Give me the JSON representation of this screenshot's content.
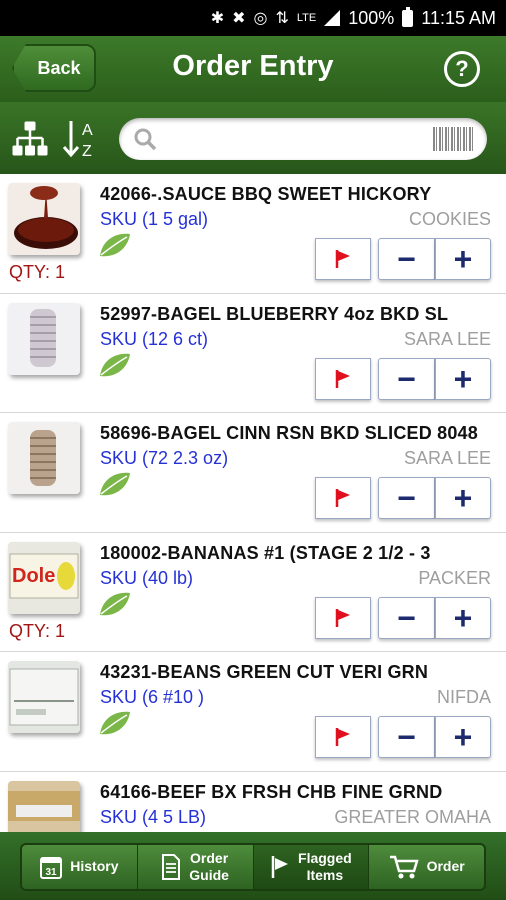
{
  "status_bar": {
    "battery": "100%",
    "time": "11:15 AM",
    "network": "LTE"
  },
  "header": {
    "back_label": "Back",
    "title": "Order Entry",
    "help_label": "?"
  },
  "search": {
    "placeholder": "",
    "value": ""
  },
  "colors": {
    "header_green": "#2f6b1f",
    "sku_blue": "#2531d6",
    "qty_red": "#a31515",
    "button_navy": "#1d2a6d",
    "flag_red": "#e0101e"
  },
  "items": [
    {
      "name": "42066-.SAUCE BBQ SWEET HICKORY",
      "sku": "SKU (1 5 gal)",
      "brand": "COOKIES",
      "qty": "QTY: 1",
      "image": "bbq-sauce-image"
    },
    {
      "name": "52997-BAGEL BLUEBERRY 4oz BKD SL",
      "sku": "SKU (12 6 ct)",
      "brand": "SARA LEE",
      "qty": "",
      "image": "bagel-image"
    },
    {
      "name": "58696-BAGEL CINN RSN BKD SLICED 8048",
      "sku": "SKU (72 2.3 oz)",
      "brand": "SARA LEE",
      "qty": "",
      "image": "bagel-image"
    },
    {
      "name": "180002-BANANAS #1 (STAGE 2 1/2 - 3",
      "sku": "SKU (40 lb)",
      "brand": "PACKER",
      "qty": "QTY: 1",
      "image": "dole-box-image"
    },
    {
      "name": "43231-BEANS GREEN CUT VERI GRN",
      "sku": "SKU (6 #10 )",
      "brand": "NIFDA",
      "qty": "",
      "image": "case-box-image"
    },
    {
      "name": "64166-BEEF BX FRSH CHB FINE GRND",
      "sku": "SKU (4 5 LB)",
      "brand": "GREATER OMAHA",
      "qty": "",
      "image": "beef-box-image"
    }
  ],
  "nav": {
    "history": "History",
    "history_day": "31",
    "order_guide_1": "Order",
    "order_guide_2": "Guide",
    "flagged_1": "Flagged",
    "flagged_2": "Items",
    "order": "Order"
  }
}
